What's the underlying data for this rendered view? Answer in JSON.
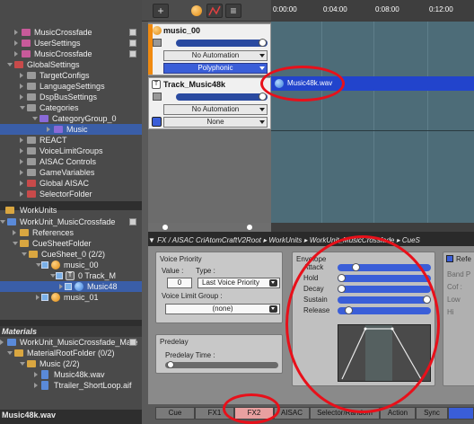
{
  "tree_top": [
    {
      "label": "MusicCrossfade",
      "indent": 26,
      "icon": "pink",
      "save": true
    },
    {
      "label": "UserSettings",
      "indent": 26,
      "icon": "pink",
      "save": true
    },
    {
      "label": "MusicCrossfade",
      "indent": 26,
      "icon": "pink",
      "save": true
    },
    {
      "label": "GlobalSettings",
      "indent": 18,
      "icon": "red",
      "open": true
    },
    {
      "label": "TargetConfigs",
      "indent": 32,
      "icon": "gray"
    },
    {
      "label": "LanguageSettings",
      "indent": 32,
      "icon": "gray"
    },
    {
      "label": "DspBusSettings",
      "indent": 32,
      "icon": "gray"
    },
    {
      "label": "Categories",
      "indent": 32,
      "icon": "gray",
      "open": true
    },
    {
      "label": "CategoryGroup_0",
      "indent": 46,
      "icon": "purple",
      "open": true
    },
    {
      "label": "Music",
      "indent": 62,
      "icon": "purple",
      "sel": true
    },
    {
      "label": "REACT",
      "indent": 32,
      "icon": "gray"
    },
    {
      "label": "VoiceLimitGroups",
      "indent": 32,
      "icon": "gray"
    },
    {
      "label": "AISAC Controls",
      "indent": 32,
      "icon": "gray"
    },
    {
      "label": "GameVariables",
      "indent": 32,
      "icon": "gray"
    },
    {
      "label": "Global AISAC",
      "indent": 32,
      "icon": "red"
    },
    {
      "label": "SelectorFolder",
      "indent": 32,
      "icon": "red"
    }
  ],
  "workunits_title": "WorkUnits",
  "tree_wu": [
    {
      "label": "WorkUnit_MusicCrossfade",
      "indent": 10,
      "icon": "blue",
      "open": true,
      "save": true
    },
    {
      "label": "References",
      "indent": 24,
      "icon": "fold"
    },
    {
      "label": "CueSheetFolder",
      "indent": 24,
      "icon": "fold",
      "open": true
    },
    {
      "label": "CueSheet_0  (2/2)",
      "indent": 34,
      "icon": "fold",
      "open": true
    },
    {
      "label": "music_00",
      "indent": 50,
      "icon": "orb",
      "check": true,
      "open": true
    },
    {
      "label": "0  Track_M",
      "indent": 66,
      "icon": "tbox",
      "check": true,
      "open": true
    },
    {
      "label": "Music48",
      "indent": 76,
      "icon": "orbblue",
      "check": true,
      "sel": true
    },
    {
      "label": "music_01",
      "indent": 50,
      "icon": "orb",
      "check": true
    }
  ],
  "materials_title": "Materials",
  "tree_mat": [
    {
      "label": "WorkUnit_MusicCrossfade_Mate",
      "indent": 10,
      "icon": "blue",
      "save": true
    },
    {
      "label": "MaterialRootFolder  (0/2)",
      "indent": 18,
      "icon": "fold",
      "open": true
    },
    {
      "label": "Music  (2/2)",
      "indent": 32,
      "icon": "fold",
      "open": true
    },
    {
      "label": "Music48k.wav",
      "indent": 48,
      "icon": "file"
    },
    {
      "label": "Ttrailer_ShortLoop.aif",
      "indent": 48,
      "icon": "file"
    }
  ],
  "bottom_status": "Music48k.wav",
  "timeline": {
    "ticks": [
      "0:00:00",
      "0:04:00",
      "0:08:00",
      "0:12:00"
    ],
    "clip_label": "Music48k.wav"
  },
  "track1": {
    "title": "music_00",
    "automation": "No Automation",
    "mode": "Polyphonic"
  },
  "track2": {
    "title": "Track_Music48k",
    "automation": "No Automation",
    "select": "None"
  },
  "breadcrumb": "▼ FX / AISAC          CriAtomCraftV2Root  ▸ WorkUnits  ▸ WorkUnit_MusicCrossfade  ▸ CueS",
  "voice": {
    "title": "Voice Priority",
    "value_label": "Value :",
    "type_label": "Type :",
    "value": "0",
    "type": "Last Voice Priority",
    "limit_label": "Voice Limit Group :",
    "limit": "(none)"
  },
  "predelay": {
    "title": "Predelay",
    "time_label": "Predelay Time :"
  },
  "envelope": {
    "title": "Envelope",
    "rows": [
      {
        "label": "Attack",
        "level": 0.17
      },
      {
        "label": "Hold",
        "level": 0.0
      },
      {
        "label": "Decay",
        "level": 0.0
      },
      {
        "label": "Sustain",
        "level": 1.0
      },
      {
        "label": "Release",
        "level": 0.08
      }
    ]
  },
  "right_box": {
    "title": "Refe",
    "lines": [
      "Band P",
      "Cof :",
      "Low",
      "Hi"
    ]
  },
  "tabs": [
    "Cue",
    "FX1",
    "FX2",
    "AISAC",
    "Selector/Random",
    "Action",
    "Sync"
  ],
  "active_tab": "FX2"
}
